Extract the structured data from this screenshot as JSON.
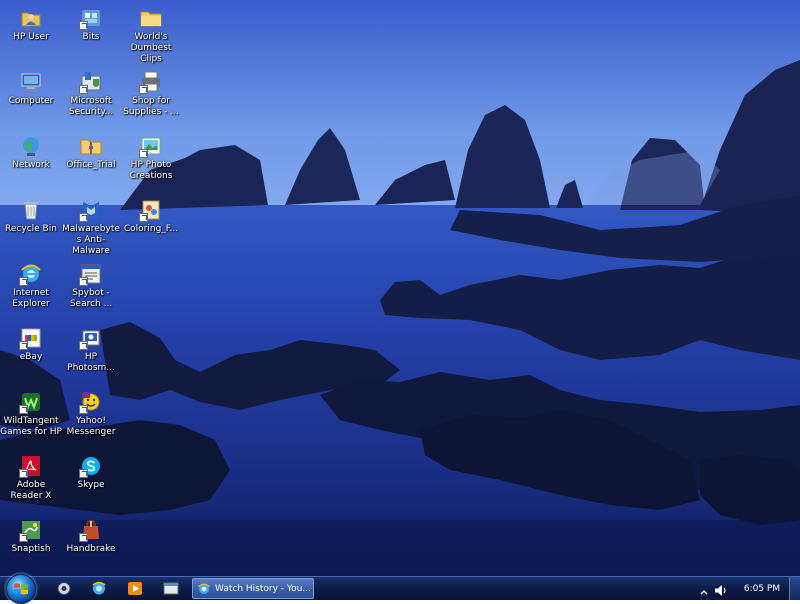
{
  "desktop": {
    "icons": [
      {
        "id": "hp-user",
        "label": "HP User",
        "icon": "user-folder-icon",
        "col": 0,
        "row": 0,
        "shortcut": false
      },
      {
        "id": "bits",
        "label": "Bits",
        "icon": "bits-app-icon",
        "col": 1,
        "row": 0,
        "shortcut": true
      },
      {
        "id": "worlds-dumbest-clips",
        "label": "World's Dumbest Clips",
        "icon": "folder-icon",
        "col": 2,
        "row": 0,
        "shortcut": false
      },
      {
        "id": "computer",
        "label": "Computer",
        "icon": "computer-icon",
        "col": 0,
        "row": 1,
        "shortcut": false
      },
      {
        "id": "microsoft-security",
        "label": "Microsoft Security...",
        "icon": "security-icon",
        "col": 1,
        "row": 1,
        "shortcut": true
      },
      {
        "id": "shop-for-supplies",
        "label": "Shop for Supplies - ...",
        "icon": "printer-icon",
        "col": 2,
        "row": 1,
        "shortcut": true
      },
      {
        "id": "network",
        "label": "Network",
        "icon": "network-globe-icon",
        "col": 0,
        "row": 2,
        "shortcut": false
      },
      {
        "id": "office-trial",
        "label": "Office_Trial",
        "icon": "folder-zip-icon",
        "col": 1,
        "row": 2,
        "shortcut": false
      },
      {
        "id": "hp-photo-creations",
        "label": "HP Photo Creations",
        "icon": "photo-creations-icon",
        "col": 2,
        "row": 2,
        "shortcut": true
      },
      {
        "id": "recycle-bin",
        "label": "Recycle Bin",
        "icon": "recycle-bin-icon",
        "col": 0,
        "row": 3,
        "shortcut": false
      },
      {
        "id": "malwarebytes",
        "label": "Malwarebytes Anti-Malware",
        "icon": "malwarebytes-icon",
        "col": 1,
        "row": 3,
        "shortcut": true
      },
      {
        "id": "coloring",
        "label": "Coloring_F...",
        "icon": "coloring-icon",
        "col": 2,
        "row": 3,
        "shortcut": true
      },
      {
        "id": "internet-explorer",
        "label": "Internet Explorer",
        "icon": "internet-explorer-icon",
        "col": 0,
        "row": 4,
        "shortcut": true
      },
      {
        "id": "spybot",
        "label": "Spybot - Search ...",
        "icon": "spybot-icon",
        "col": 1,
        "row": 4,
        "shortcut": true
      },
      {
        "id": "ebay",
        "label": "eBay",
        "icon": "ebay-icon",
        "col": 0,
        "row": 5,
        "shortcut": true
      },
      {
        "id": "hp-photosmart",
        "label": "HP Photosm...",
        "icon": "photosmart-icon",
        "col": 1,
        "row": 5,
        "shortcut": true
      },
      {
        "id": "wildtangent",
        "label": "WildTangent Games for HP",
        "icon": "wildtangent-icon",
        "col": 0,
        "row": 6,
        "shortcut": true
      },
      {
        "id": "yahoo-messenger",
        "label": "Yahoo! Messenger",
        "icon": "yahoo-messenger-icon",
        "col": 1,
        "row": 6,
        "shortcut": true
      },
      {
        "id": "adobe-reader",
        "label": "Adobe Reader X",
        "icon": "adobe-reader-icon",
        "col": 0,
        "row": 7,
        "shortcut": true
      },
      {
        "id": "skype",
        "label": "Skype",
        "icon": "skype-icon",
        "col": 1,
        "row": 7,
        "shortcut": true
      },
      {
        "id": "snaptish",
        "label": "Snaptish",
        "icon": "snaptish-icon",
        "col": 0,
        "row": 8,
        "shortcut": true
      },
      {
        "id": "handbrake",
        "label": "Handbrake",
        "icon": "handbrake-icon",
        "col": 1,
        "row": 8,
        "shortcut": true
      }
    ]
  },
  "taskbar": {
    "start_icon": "windows-start-orb-icon",
    "quick_launch": [
      {
        "id": "quick-launch-1",
        "icon": "quick-launch-app-icon"
      },
      {
        "id": "quick-launch-2",
        "icon": "quick-launch-ie-icon"
      },
      {
        "id": "quick-launch-3",
        "icon": "media-player-icon"
      },
      {
        "id": "quick-launch-4",
        "icon": "folder-window-icon"
      }
    ],
    "active_window": {
      "label": "Watch History - You...",
      "icon": "internet-explorer-icon"
    },
    "tray": {
      "expand_icon": "tray-expand-arrow-icon",
      "volume_icon": "volume-icon",
      "clock": "6:05 PM"
    }
  },
  "colors": {
    "taskbar": "#0b1a45",
    "accent": "#2a8fe0",
    "sky": "#6e97e6",
    "water": "#1b2f86"
  }
}
